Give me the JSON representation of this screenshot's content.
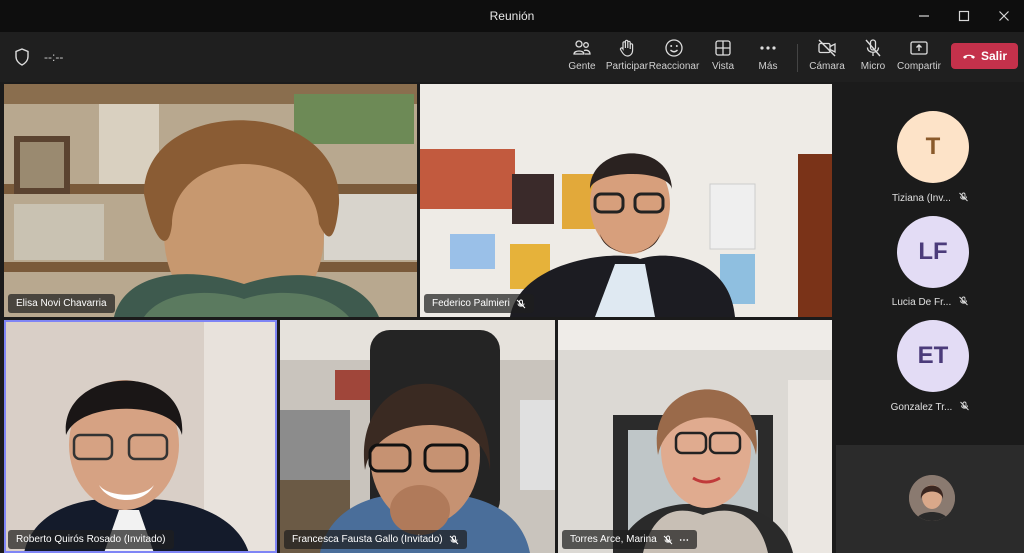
{
  "window": {
    "title": "Reunión"
  },
  "toolbar": {
    "timer": "--:--",
    "items": [
      {
        "label": "Gente",
        "icon": "people-icon"
      },
      {
        "label": "Participar",
        "icon": "raise-hand-icon"
      },
      {
        "label": "Reaccionar",
        "icon": "smile-icon"
      },
      {
        "label": "Vista",
        "icon": "grid-view-icon"
      },
      {
        "label": "Más",
        "icon": "more-icon"
      },
      {
        "label": "Cámara",
        "icon": "camera-off-icon"
      },
      {
        "label": "Micro",
        "icon": "mic-off-icon"
      },
      {
        "label": "Compartir",
        "icon": "share-icon"
      }
    ],
    "leave_label": "Salir"
  },
  "participants": [
    {
      "name": "Elisa Novi Chavarria",
      "muted": false
    },
    {
      "name": "Federico Palmieri",
      "muted": true
    },
    {
      "name": "Roberto Quirós Rosado (Invitado)",
      "muted": false,
      "active_speaker": true
    },
    {
      "name": "Francesca Fausta Gallo (Invitado)",
      "muted": true
    },
    {
      "name": "Torres Arce, Marina",
      "muted": true,
      "has_more": true
    }
  ],
  "roster": [
    {
      "initials": "T",
      "name": "Tiziana (Inv...",
      "bg": "#fde3c8",
      "fg": "#8a5a2b"
    },
    {
      "initials": "LF",
      "name": "Lucia De Fr...",
      "bg": "#e3dcf5",
      "fg": "#4b3b7a"
    },
    {
      "initials": "ET",
      "name": "Gonzalez Tr...",
      "bg": "#e3dcf5",
      "fg": "#4b3b7a"
    }
  ],
  "colors": {
    "accent": "#7f85f5",
    "leave": "#c4314b"
  }
}
